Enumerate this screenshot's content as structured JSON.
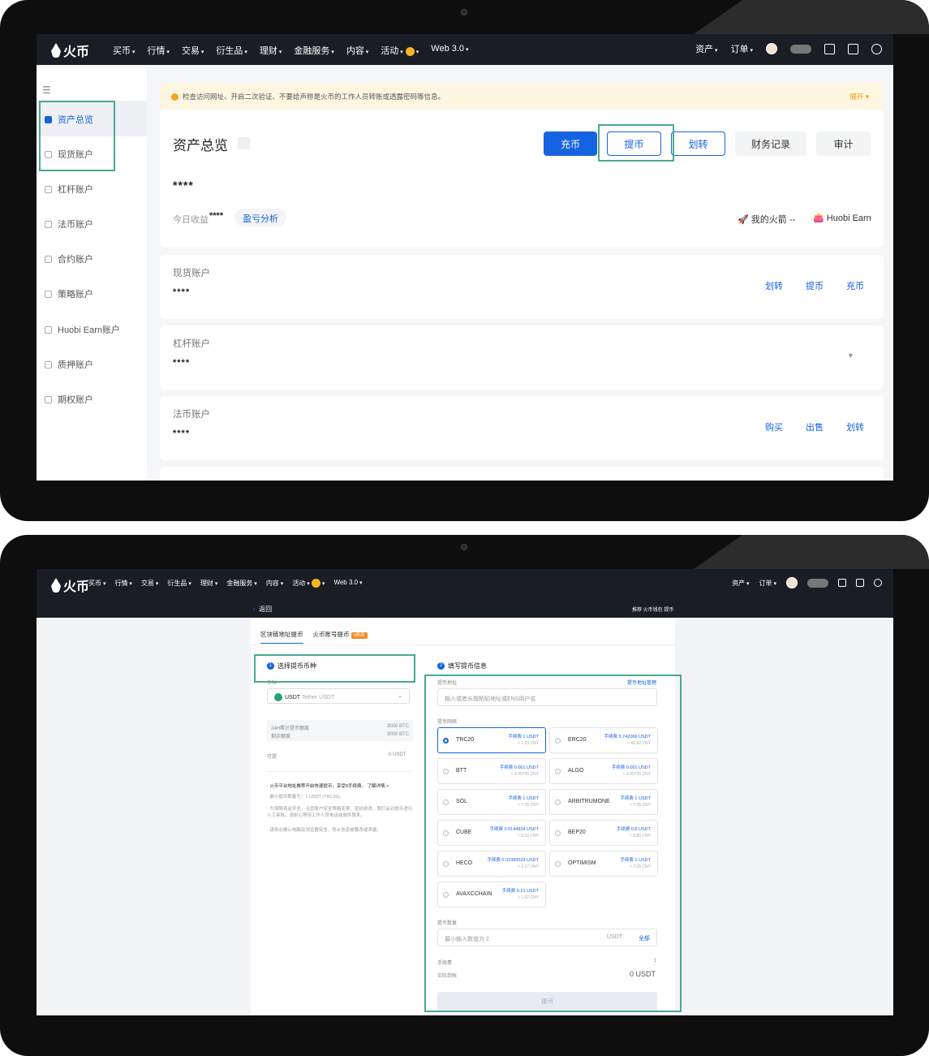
{
  "nav": {
    "logo": "火币",
    "menu": [
      "买币",
      "行情",
      "交易",
      "衍生品",
      "理财",
      "金融服务",
      "内容",
      "活动",
      "Web 3.0"
    ],
    "right": [
      "资产",
      "订单"
    ]
  },
  "screen1": {
    "sidebar": [
      "资产总览",
      "现货账户",
      "杠杆账户",
      "法币账户",
      "合约账户",
      "策略账户",
      "Huobi Earn账户",
      "质押账户",
      "期权账户"
    ],
    "notice": "检查访问网址、开启二次验证、不要给声称是火币的工作人员转账或透露密码等信息。",
    "notice_more": "展开",
    "title": "资产总览",
    "buttons": {
      "deposit": "充币",
      "withdraw": "提币",
      "transfer": "划转",
      "records": "财务记录",
      "audit": "审计"
    },
    "balance": "****",
    "today_label": "今日收益",
    "today_value": "****",
    "pnl": "盈亏分析",
    "rocket": "我的火箭",
    "rocket_value": "--",
    "earn": "Huobi Earn",
    "accounts": [
      {
        "title": "现货账户",
        "value": "****",
        "links": [
          "划转",
          "提币",
          "充币"
        ]
      },
      {
        "title": "杠杆账户",
        "value": "****",
        "links": []
      },
      {
        "title": "法币账户",
        "value": "****",
        "links": [
          "购买",
          "出售",
          "划转"
        ]
      }
    ]
  },
  "screen2": {
    "back": "返回",
    "recommend": "推荐 火币钱包 提币",
    "tab1": "区块链地址提币",
    "tab2": "火币账号提币",
    "tab2_badge": "0费用",
    "step1": "选择提币币种",
    "step2": "填写提币信息",
    "coin_label": "币种",
    "coin_value": "USDT",
    "coin_sub": "Tether USDT",
    "quota": [
      [
        "24H累计提币额度",
        "3000 BTC"
      ],
      [
        "剩余额度",
        "3000 BTC"
      ]
    ],
    "available_label": "可提",
    "available_value": "0 USDT",
    "notes": [
      "· 火币平台地址推荐开启快速提币，享受0手续费。 了解详情 >",
      "· 最小提币数量为：1 USDT (TRC20)。",
      "· 为保障资金安全，当您账户安全策略变更、密码修改、我们会对提币进行人工审核，请耐心等待工作人员电话或邮件联系。",
      "· 请务必确认电脑及浏览器安全，防止信息被篡改或泄露。"
    ],
    "addr_label": "提币地址",
    "addr_manage": "提币地址管理",
    "addr_placeholder": "输入或者长按粘贴地址或ENS用户名",
    "network_label": "提币网络",
    "networks": [
      {
        "name": "TRC20",
        "fee": "手续费 1 USDT",
        "cny": "≈ 7.25 CNY"
      },
      {
        "name": "ERC20",
        "fee": "手续费 5.742066 USDT",
        "cny": "≈ 41.62 CNY"
      },
      {
        "name": "BTT",
        "fee": "手续费 0.001 USDT",
        "cny": "≈ 0.00725 CNY"
      },
      {
        "name": "ALGO",
        "fee": "手续费 0.001 USDT",
        "cny": "≈ 0.00725 CNY"
      },
      {
        "name": "SOL",
        "fee": "手续费 1 USDT",
        "cny": "≈ 7.25 CNY"
      },
      {
        "name": "ARBITRUMONE",
        "fee": "手续费 1 USDT",
        "cny": "≈ 7.25 CNY"
      },
      {
        "name": "CUBE",
        "fee": "手续费 0.0144834 USDT",
        "cny": "≈ 0.10 CNY"
      },
      {
        "name": "BEP20",
        "fee": "手续费 0.8 USDT",
        "cny": "≈ 5.80 CNY"
      },
      {
        "name": "HECO",
        "fee": "手续费 0.02389532 USDT",
        "cny": "≈ 0.17 CNY"
      },
      {
        "name": "OPTIMISM",
        "fee": "手续费 1 USDT",
        "cny": "≈ 7.25 CNY"
      },
      {
        "name": "AVAXCCHAIN",
        "fee": "手续费 0.21 USDT",
        "cny": "≈ 1.52 CNY"
      }
    ],
    "amount_label": "提币数量",
    "amount_placeholder": "最小输入数值为 2",
    "amount_unit": "USDT",
    "amount_all": "全部",
    "fee_label": "手续费",
    "fee_value": "1",
    "receive_label": "实际到账",
    "receive_value": "0 USDT",
    "submit": "提币"
  }
}
